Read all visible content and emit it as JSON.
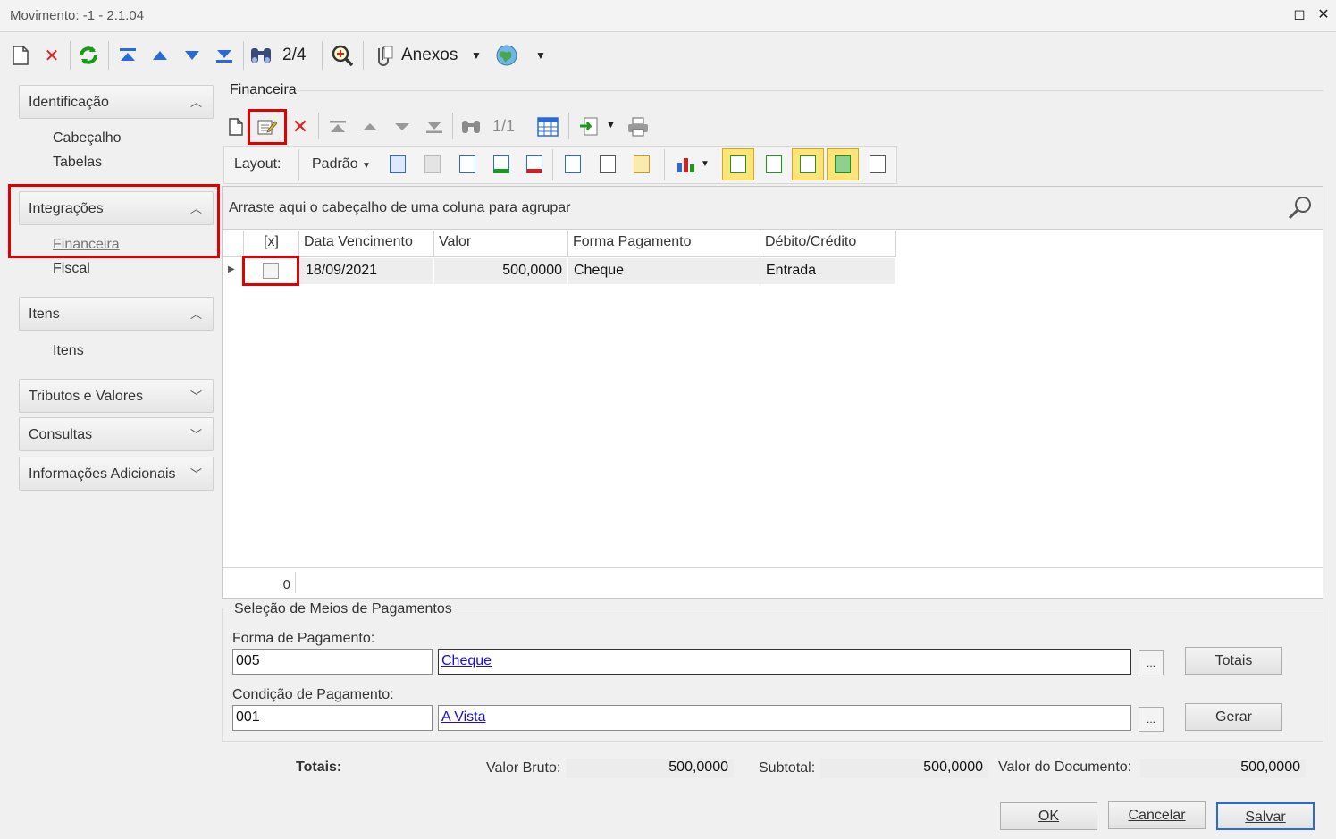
{
  "window": {
    "title": "Movimento: -1 - 2.1.04",
    "maximize_glyph": "◻",
    "close_glyph": "✕"
  },
  "toolbar": {
    "record_counter": "2/4",
    "attachments_label": "Anexos"
  },
  "nav": {
    "groups": [
      {
        "label": "Identificação",
        "expanded": true,
        "items": [
          "Cabeçalho",
          "Tabelas"
        ]
      },
      {
        "label": "Integrações",
        "expanded": true,
        "items": [
          "Financeira",
          "Fiscal"
        ]
      },
      {
        "label": "Itens",
        "expanded": true,
        "items": [
          "Itens"
        ]
      },
      {
        "label": "Tributos e Valores",
        "expanded": false,
        "items": []
      },
      {
        "label": "Consultas",
        "expanded": false,
        "items": []
      },
      {
        "label": "Informações Adicionais",
        "expanded": false,
        "items": []
      }
    ],
    "active_item": "Financeira"
  },
  "financeira": {
    "title": "Financeira",
    "record_counter": "1/1",
    "layout_label": "Layout:",
    "layout_value": "Padrão",
    "group_hint": "Arraste aqui o cabeçalho de uma coluna para agrupar",
    "columns": [
      "[x]",
      "Data Vencimento",
      "Valor",
      "Forma Pagamento",
      "Débito/Crédito"
    ],
    "rows": [
      {
        "selected": false,
        "data_vencimento": "18/09/2021",
        "valor": "500,0000",
        "forma_pagamento": "Cheque",
        "debito_credito": "Entrada"
      }
    ],
    "footer_count": "0"
  },
  "selecao": {
    "title": "Seleção de Meios de Pagamentos",
    "forma_label": "Forma de Pagamento:",
    "forma_code": "005",
    "forma_desc": "Cheque",
    "condicao_label": "Condição de Pagamento:",
    "condicao_code": "001",
    "condicao_desc": "A Vista",
    "ellipsis": "...",
    "totais_button": "Totais",
    "gerar_button": "Gerar"
  },
  "totais": {
    "label": "Totais:",
    "valor_bruto_label": "Valor Bruto:",
    "valor_bruto": "500,0000",
    "subtotal_label": "Subtotal:",
    "subtotal": "500,0000",
    "valor_documento_label": "Valor do Documento:",
    "valor_documento": "500,0000"
  },
  "footer_buttons": {
    "ok": "OK",
    "cancelar": "Cancelar",
    "salvar": "Salvar"
  },
  "colors": {
    "highlight": "#e00000",
    "link": "#1a0dcc",
    "panel_bg": "#f0f0f0",
    "row_bg": "#ededed"
  }
}
